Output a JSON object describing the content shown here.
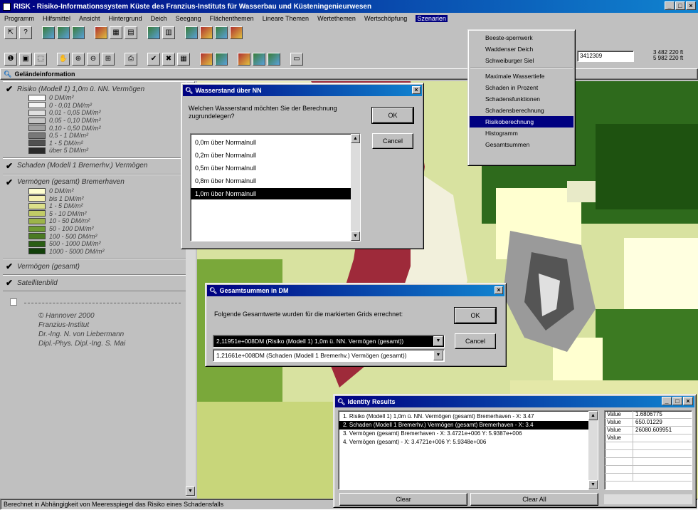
{
  "window": {
    "title": "RISK - Risiko-Informationssystem Küste des Franzius-Instituts für Wasserbau und Küsteningenieurwesen",
    "min": "_",
    "max": "□",
    "close": "×"
  },
  "menu": [
    "Programm",
    "Hilfsmittel",
    "Ansicht",
    "Hintergrund",
    "Deich",
    "Seegang",
    "Flächenthemen",
    "Lineare Themen",
    "Wertethemen",
    "Wertschöpfung",
    "Szenarien"
  ],
  "toolbar": {
    "coord_input": "3412309",
    "coord_x": "3 482 220 ft",
    "coord_y": "5 982 220 ft"
  },
  "panel": {
    "title": "Geländeinformation"
  },
  "layers": [
    {
      "title": "Risiko (Modell 1) 1,0m ü. NN. Vermögen",
      "checked": "✔",
      "legend": [
        {
          "label": "0 DM/m²",
          "color": "#ffffff"
        },
        {
          "label": "0 - 0,01 DM/m²",
          "color": "#f4f4f4"
        },
        {
          "label": "0,01 - 0,05 DM/m²",
          "color": "#e0e0e0"
        },
        {
          "label": "0,05 - 0,10 DM/m²",
          "color": "#c4c4c4"
        },
        {
          "label": "0,10 - 0,50 DM/m²",
          "color": "#a0a0a0"
        },
        {
          "label": "0,5 - 1 DM/m²",
          "color": "#787878"
        },
        {
          "label": "1 - 5 DM/m²",
          "color": "#505050"
        },
        {
          "label": "über 5 DM/m²",
          "color": "#2a2a2a"
        }
      ]
    },
    {
      "title": "Schaden (Modell 1 Bremerhv.) Vermögen",
      "checked": "✔",
      "legend": []
    },
    {
      "title": "Vermögen (gesamt) Bremerhaven",
      "checked": "✔",
      "legend": [
        {
          "label": "0 DM/m²",
          "color": "#ffffd0"
        },
        {
          "label": "bis 1 DM/m²",
          "color": "#f4f0b0"
        },
        {
          "label": "1 - 5 DM/m²",
          "color": "#dce08a"
        },
        {
          "label": "5 - 10 DM/m²",
          "color": "#c2cc66"
        },
        {
          "label": "10 - 50 DM/m²",
          "color": "#9cb44a"
        },
        {
          "label": "50 - 100 DM/m²",
          "color": "#6e9a34"
        },
        {
          "label": "100 - 500 DM/m²",
          "color": "#4a7a22"
        },
        {
          "label": "500 - 1000 DM/m²",
          "color": "#2a5e14"
        },
        {
          "label": "1000 - 5000 DM/m²",
          "color": "#12400a"
        }
      ]
    },
    {
      "title": "Vermögen (gesamt)",
      "checked": "✔",
      "legend": []
    },
    {
      "title": "Satellitenbild",
      "checked": "✔",
      "legend": []
    }
  ],
  "credits": [
    "© Hannover 2000",
    "Franzius-Institut",
    "Dr.-Ing. N. von Liebermann",
    "Dipl.-Phys. Dipl.-Ing. S. Mai"
  ],
  "status": "Berechnet in Abhängigkeit von Meeresspiegel das Risiko eines Schadensfalls",
  "scenario_menu": {
    "items1": [
      "Beeste-sperrwerk",
      "Waddenser Deich",
      "Schweiburger Siel"
    ],
    "items2": [
      "Maximale Wassertiefe",
      "Schaden in Prozent",
      "Schadensfunktionen",
      "Schadensberechnung",
      "Risikoberechnung",
      "Histogramm",
      "Gesamtsummen"
    ],
    "highlighted": "Risikoberechnung"
  },
  "dialog_wasser": {
    "title": "Wasserstand über NN",
    "prompt": "Welchen Wasserstand möchten Sie der Berechnung zugrundelegen?",
    "ok": "OK",
    "cancel": "Cancel",
    "options": [
      "0,0m über Normalnull",
      "0,2m über Normalnull",
      "0,5m über Normalnull",
      "0,8m über Normalnull",
      "1,0m über Normalnull"
    ],
    "selected_index": 4
  },
  "dialog_summen": {
    "title": "Gesamtsummen in DM",
    "prompt": "Folgende Gesamtwerte wurden für die markierten Grids errechnet:",
    "ok": "OK",
    "cancel": "Cancel",
    "row1": "2,11951e+008DM (Risiko (Modell 1) 1,0m ü. NN. Vermögen (gesamt))",
    "row2": "1,21661e+008DM (Schaden (Modell 1 Bremerhv.) Vermögen (gesamt))"
  },
  "identity": {
    "title": "Identity Results",
    "rows": [
      "1. Risiko (Modell 1) 1,0m ü. NN. Vermögen (gesamt) Bremerhaven - X: 3.47",
      "2. Schaden (Modell 1 Bremerhv.) Vermögen (gesamt) Bremerhaven - X: 3.4",
      "3. Vermögen (gesamt) Bremerhaven - X: 3.4721e+006  Y: 5.9387e+006",
      "4. Vermögen (gesamt) - X: 3.4721e+006  Y: 5.9348e+006"
    ],
    "selected_index": 1,
    "grid": [
      {
        "key": "Value",
        "val": "1.6806775"
      },
      {
        "key": "Value",
        "val": "650.01229"
      },
      {
        "key": "Value",
        "val": "26080.609951"
      },
      {
        "key": "Value",
        "val": ""
      }
    ],
    "clear": "Clear",
    "clear_all": "Clear All"
  }
}
